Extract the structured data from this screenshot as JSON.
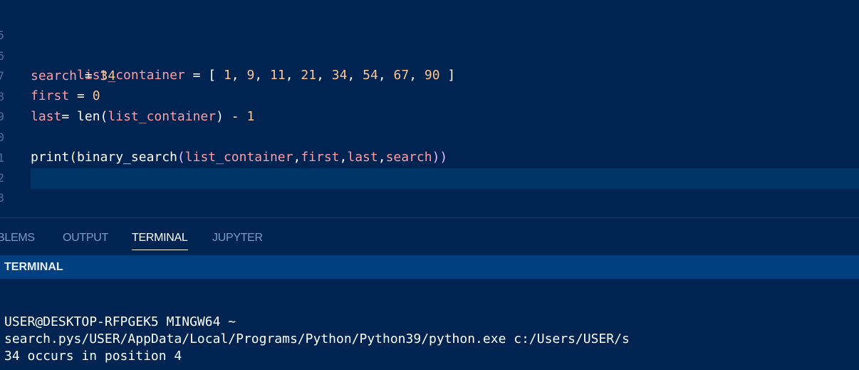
{
  "editor": {
    "line_numbers": [
      "5",
      "6",
      "7",
      "8",
      "9",
      "0",
      "1",
      "2",
      "3"
    ],
    "line1": {
      "var": "list_container",
      "eq": " = [ ",
      "nums": [
        "1",
        "9",
        "11",
        "21",
        "34",
        "54",
        "67",
        "90"
      ],
      "close": " ]"
    },
    "line2": {
      "var": "search",
      "eq": " = ",
      "num": "34"
    },
    "line3": {
      "var": "first",
      "eq": " = ",
      "num": "0"
    },
    "line4": {
      "var": "last",
      "eq": "= len(",
      "arg": "list_container",
      "tail": ") - ",
      "num": "1"
    },
    "line6": {
      "fn": "print",
      "open1": "(",
      "fn2": "binary_search",
      "open2": "(",
      "args": [
        "list_container",
        "first",
        "last",
        "search"
      ],
      "close": "))"
    }
  },
  "panel": {
    "tabs": [
      "BLEMS",
      "OUTPUT",
      "TERMINAL",
      "JUPYTER"
    ],
    "active_tab": "TERMINAL",
    "section_title": "TERMINAL"
  },
  "terminal": {
    "lines": [
      "USER@DESKTOP-RFPGEK5 MINGW64 ~",
      "search.pys/USER/AppData/Local/Programs/Python/Python39/python.exe c:/Users/USER/s",
      "34 occurs in position 4"
    ]
  }
}
